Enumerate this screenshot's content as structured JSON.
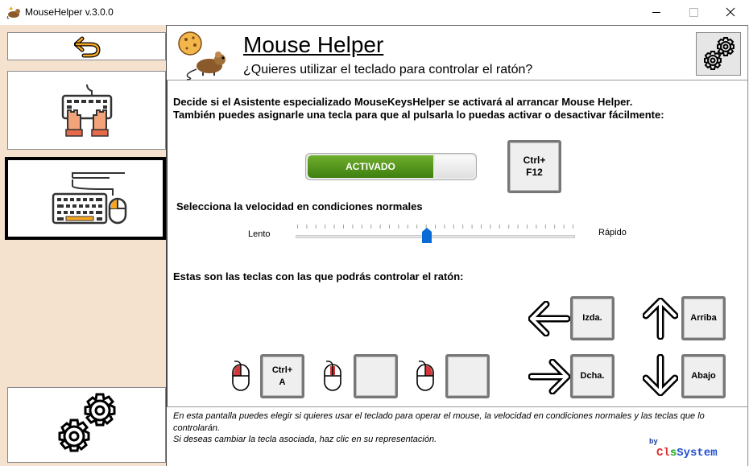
{
  "window": {
    "title": "MouseHelper v.3.0.0",
    "minimize_glyph": "—",
    "maximize_glyph": "☐",
    "close_glyph": "✕"
  },
  "sidebar": {
    "items": [
      {
        "name": "back",
        "icon": "undo-arrow-icon"
      },
      {
        "name": "keyboard-hands",
        "icon": "keyboard-hands-icon"
      },
      {
        "name": "keyboard-mouse",
        "icon": "keyboard-mouse-icon",
        "selected": true
      },
      {
        "name": "settings",
        "icon": "gears-icon"
      }
    ]
  },
  "header": {
    "title": "Mouse Helper",
    "subtitle": "¿Quieres utilizar el teclado para controlar el ratón?"
  },
  "description": {
    "line1": "Decide si el Asistente especializado MouseKeysHelper se activará al arrancar Mouse Helper.",
    "line2": "También puedes asignarle una tecla para que al pulsarla lo puedas activar o desactivar fácilmente:"
  },
  "toggle": {
    "label": "ACTIVADO",
    "state": "on",
    "on_color": "#4c8c17"
  },
  "hotkey": {
    "line1": "Ctrl+",
    "line2": "F12"
  },
  "speed": {
    "label": "Selecciona la velocidad en condiciones normales",
    "min_label": "Lento",
    "max_label": "Rápido",
    "value_fraction": 0.47,
    "ticks": 30
  },
  "keys_section": {
    "label": "Estas son las teclas con las que podrás controlar el ratón:",
    "left_key": "Izda.",
    "right_key": "Dcha.",
    "up_key": "Arriba",
    "down_key": "Abajo",
    "mouse_buttons": [
      {
        "icon": "mouse-left-click-icon",
        "key_line1": "Ctrl+",
        "key_line2": "A"
      },
      {
        "icon": "mouse-middle-click-icon",
        "key_line1": "",
        "key_line2": ""
      },
      {
        "icon": "mouse-right-click-icon",
        "key_line1": "",
        "key_line2": ""
      }
    ]
  },
  "footer": {
    "text": "En esta pantalla puedes elegir si quieres usar el teclado para operar el mouse, la velocidad en condiciones normales y las teclas que lo controlarán.",
    "hint": "Si deseas cambiar la tecla asociada, haz clic en su representación.",
    "by": "by",
    "brand_part1": "Cl",
    "brand_part2": "s",
    "brand_part3": "System"
  },
  "colors": {
    "sidebar_bg": "#f4e2cf",
    "accent_orange": "#f5a623",
    "mouse_red": "#d0383b"
  }
}
